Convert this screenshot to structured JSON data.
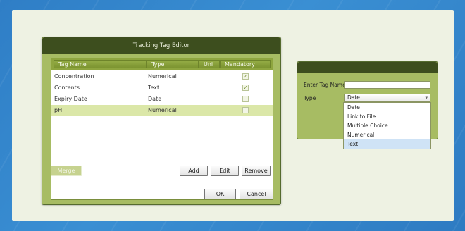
{
  "editor": {
    "title": "Tracking Tag Editor",
    "columns": [
      "Tag Name",
      "Type",
      "Uni",
      "Mandatory"
    ],
    "rows": [
      {
        "name": "Concentration",
        "type": "Numerical",
        "mandatory": true
      },
      {
        "name": "Contents",
        "type": "Text",
        "mandatory": true
      },
      {
        "name": "Expiry Date",
        "type": "Date",
        "mandatory": false
      },
      {
        "name": "pH",
        "type": "Numerical",
        "mandatory": false
      }
    ],
    "selected_row": 3,
    "buttons": {
      "merge": "Merge",
      "add": "Add",
      "edit": "Edit",
      "remove": "Remove",
      "ok": "OK",
      "cancel": "Cancel"
    }
  },
  "dialog": {
    "tag_name_label": "Enter Tag Name",
    "tag_name_value": "",
    "type_label": "Type",
    "type_value": "Date",
    "options": [
      "Date",
      "Link to File",
      "Multiple Choice",
      "Numerical",
      "Text"
    ],
    "highlighted_option": "Text"
  }
}
